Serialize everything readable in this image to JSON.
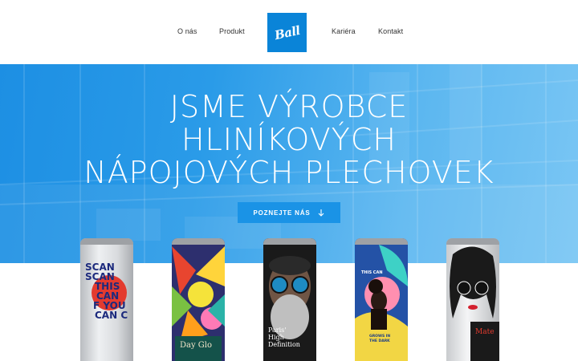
{
  "nav": {
    "left": [
      "O nás",
      "Produkt"
    ],
    "right": [
      "Kariéra",
      "Kontakt"
    ],
    "logo_text": "Ball"
  },
  "hero": {
    "headline": [
      "JSME VÝROBCE",
      "HLINÍKOVÝCH",
      "NÁPOJOVÝCH PLECHOVEK"
    ],
    "cta_label": "POZNEJTE NÁS"
  },
  "cans": {
    "can1": [
      "SCAN",
      "SCAN",
      "THIS",
      "CAN",
      "F YOU",
      "CAN C"
    ],
    "can2": "Day Glo",
    "can3": [
      "Paris'",
      "High",
      "Definition"
    ],
    "can4": [
      "THIS CAN",
      "GROWS IN",
      "THE DARK"
    ],
    "can5": "Mate"
  },
  "colors": {
    "brand": "#0a84d8",
    "hero_gradient_start": "#1d8fe3",
    "hero_gradient_end": "#7ac6f4",
    "cta": "#1a93e6"
  }
}
